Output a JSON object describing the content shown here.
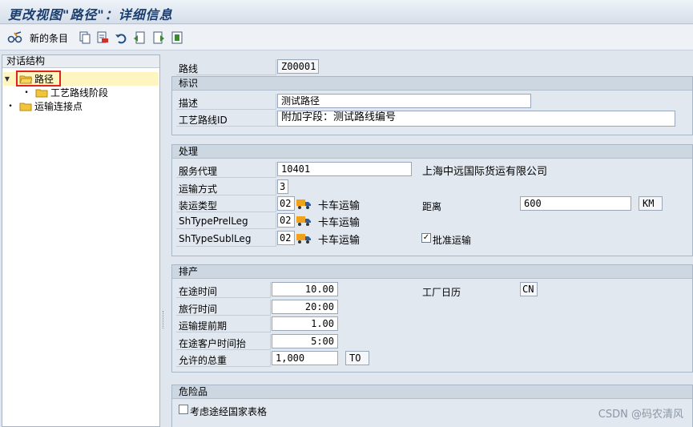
{
  "window": {
    "title": "更改视图\"路径\"：详细信息"
  },
  "toolbar": {
    "new_entries_label": "新的条目"
  },
  "left_pane": {
    "header": "对话结构",
    "tree": [
      {
        "label": "路径",
        "expanded": true,
        "selected": true
      },
      {
        "label": "工艺路线阶段",
        "level": 1
      },
      {
        "label": "运输连接点"
      }
    ]
  },
  "route": {
    "label": "路线",
    "value": "Z00001"
  },
  "identification": {
    "title": "标识",
    "desc_label": "描述",
    "desc_value": "测试路径",
    "process_route_id_label": "工艺路线ID",
    "process_route_id_value": "附加字段：测试路线编号"
  },
  "processing": {
    "title": "处理",
    "agent_label": "服务代理",
    "agent_value": "10401",
    "agent_name": "上海中远国际货运有限公司",
    "transport_mode_label": "运输方式",
    "transport_mode_value": "3",
    "ship_type_label": "装运类型",
    "ship_type_value": "02",
    "ship_type_text": "卡车运输",
    "prel_leg_label": "ShTypePrelLeg",
    "prel_leg_value": "02",
    "prel_leg_text": "卡车运输",
    "subl_leg_label": "ShTypeSublLeg",
    "subl_leg_value": "02",
    "subl_leg_text": "卡车运输",
    "distance_label": "距离",
    "distance_value": "600",
    "distance_unit": "KM",
    "approve_label": "批准运输",
    "approve_checked": "✓"
  },
  "scheduling": {
    "title": "排产",
    "transit_time_label": "在途时间",
    "transit_time_value": "10.00",
    "travel_time_label": "旅行时间",
    "travel_time_value": "20:00",
    "lead_time_label": "运输提前期",
    "lead_time_value": "1.00",
    "customer_time_label": "在途客户时间抬",
    "customer_time_value": "5:00",
    "total_weight_label": "允许的总重",
    "total_weight_value": "1,000",
    "total_weight_unit": "TO",
    "factory_cal_label": "工厂日历",
    "factory_cal_value": "CN"
  },
  "hazardous": {
    "title": "危险品",
    "consider_label": "考虑途经国家表格"
  },
  "watermark": "CSDN @码农清风"
}
